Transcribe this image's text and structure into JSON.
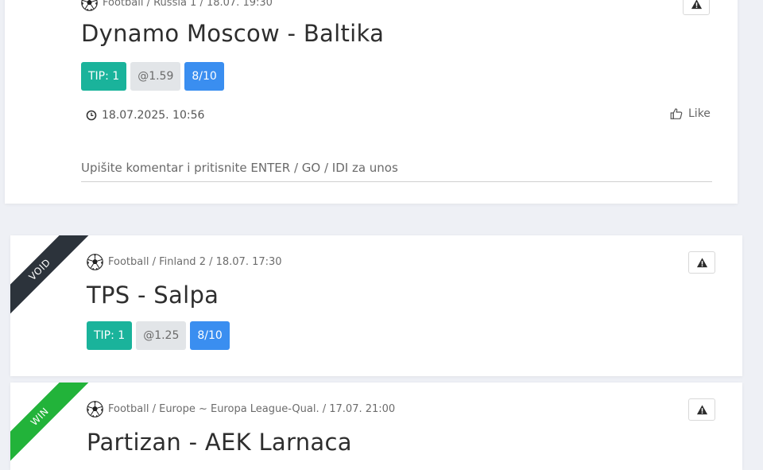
{
  "colors": {
    "tip": "#1ab39b",
    "odds": "#e2e5e8",
    "confidence": "#3a8ef0",
    "void_ribbon": "#2c333b",
    "win_ribbon": "#22b33a"
  },
  "icons": {
    "sport": "soccer-ball-icon",
    "report": "warning-triangle-icon",
    "time": "clock-icon",
    "like": "thumbs-up-icon"
  },
  "cards": [
    {
      "meta": "Football / Russia 1 / 18.07. 19:30",
      "title": "Dynamo Moscow - Baltika",
      "tip": "TIP: 1",
      "odds": "@1.59",
      "confidence": "8/10",
      "posted": "18.07.2025. 10:56",
      "like_label": "Like",
      "comment_placeholder": "Upišite komentar i pritisnite ENTER / GO / IDI za unos"
    },
    {
      "ribbon": "VOID",
      "meta": "Football / Finland 2 / 18.07. 17:30",
      "title": "TPS - Salpa",
      "tip": "TIP: 1",
      "odds": "@1.25",
      "confidence": "8/10"
    },
    {
      "ribbon": "WIN",
      "meta": "Football / Europe ~ Europa League-Qual. / 17.07. 21:00",
      "title": "Partizan - AEK Larnaca"
    }
  ]
}
